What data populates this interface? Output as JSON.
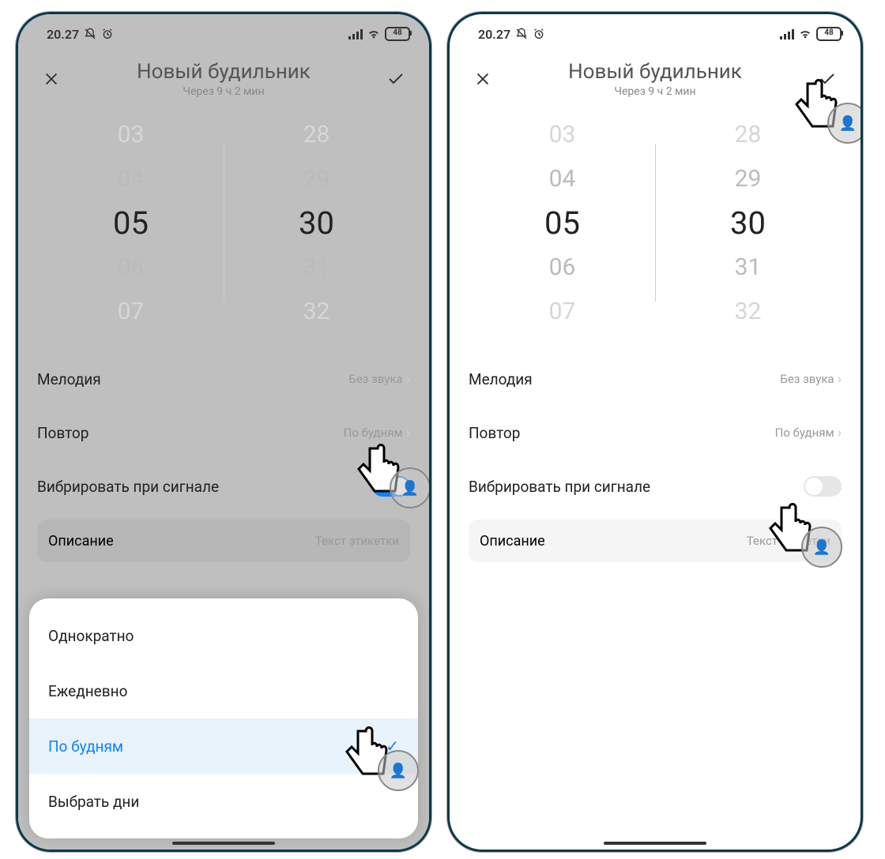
{
  "status": {
    "time": "20.27",
    "battery": "48"
  },
  "header": {
    "title": "Новый будильник",
    "subtitle": "Через 9 ч 2 мин"
  },
  "timepicker": {
    "hours": [
      "03",
      "04",
      "05",
      "06",
      "07"
    ],
    "minutes": [
      "28",
      "29",
      "30",
      "31",
      "32"
    ]
  },
  "rows": {
    "melody_label": "Мелодия",
    "melody_value": "Без звука",
    "repeat_label": "Повтор",
    "repeat_value": "По будням",
    "vibrate_label": "Вибрировать при сигнале",
    "desc_label": "Описание",
    "desc_placeholder": "Текст этикетки"
  },
  "sheet": {
    "opt1": "Однократно",
    "opt2": "Ежедневно",
    "opt3": "По будням",
    "opt4": "Выбрать дни"
  }
}
